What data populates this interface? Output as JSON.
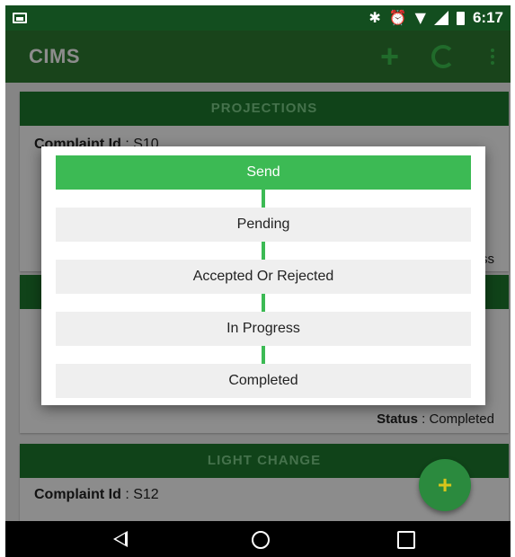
{
  "status_bar": {
    "time": "6:17"
  },
  "app_bar": {
    "title": "CIMS"
  },
  "cards": [
    {
      "header": "PROJECTIONS",
      "complaint_label": "Complaint Id",
      "complaint_id": "S10",
      "status_fragment": "ss"
    },
    {
      "status_label": "Status",
      "status_value": "Completed"
    },
    {
      "header": "LIGHT CHANGE",
      "complaint_label": "Complaint Id",
      "complaint_id": "S12"
    }
  ],
  "dialog": {
    "steps": [
      {
        "label": "Send",
        "active": true
      },
      {
        "label": "Pending",
        "active": false
      },
      {
        "label": "Accepted Or Rejected",
        "active": false
      },
      {
        "label": "In Progress",
        "active": false
      },
      {
        "label": "Completed",
        "active": false
      }
    ]
  },
  "fab": {
    "symbol": "+"
  },
  "colors": {
    "primary_dark": "#134e1f",
    "primary": "#2e7d32",
    "accent": "#3cba54"
  }
}
